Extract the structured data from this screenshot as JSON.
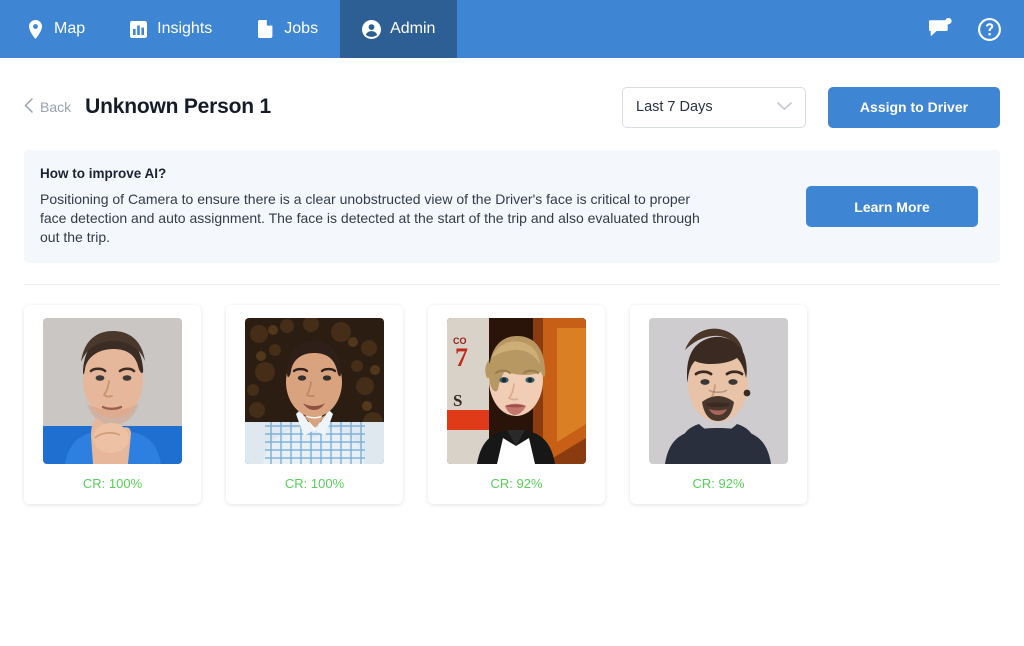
{
  "nav": {
    "tabs": [
      {
        "label": "Map",
        "icon": "map-pin-icon",
        "active": false
      },
      {
        "label": "Insights",
        "icon": "bar-chart-icon",
        "active": false
      },
      {
        "label": "Jobs",
        "icon": "document-icon",
        "active": false
      },
      {
        "label": "Admin",
        "icon": "user-icon",
        "active": true
      }
    ],
    "actions": [
      {
        "icon": "message-bubble-icon",
        "badge": true
      },
      {
        "icon": "help-circle-icon",
        "badge": false
      }
    ],
    "colors": {
      "bar": "#3e86d4",
      "active_tab": "#2d5f94",
      "text": "#ffffff"
    }
  },
  "titlebar": {
    "back_label": "Back",
    "title": "Unknown Person 1",
    "date_filter": {
      "value": "Last 7 Days",
      "placeholder": "Last 7 Days"
    },
    "assign_button": "Assign to Driver"
  },
  "banner": {
    "title": "How to improve AI?",
    "body": "Positioning of Camera to ensure there is a clear unobstructed view of the Driver's face is critical to proper face detection and auto assignment. The face is detected at the start of the trip and also evaluated through out the trip.",
    "learn_more_button": "Learn More"
  },
  "faces": {
    "cr_color": "#5ace5a",
    "cards": [
      {
        "cr_label": "CR: 100%",
        "alt": "man in blue shirt hand on chin, gray backdrop"
      },
      {
        "cr_label": "CR: 100%",
        "alt": "man in blue checkered shirt, dark foliage backdrop"
      },
      {
        "cr_label": "CR: 92%",
        "alt": "woman with short blonde hair, dark orange backdrop"
      },
      {
        "cr_label": "CR: 92%",
        "alt": "bearded man in navy shirt, light gray backdrop"
      }
    ]
  }
}
